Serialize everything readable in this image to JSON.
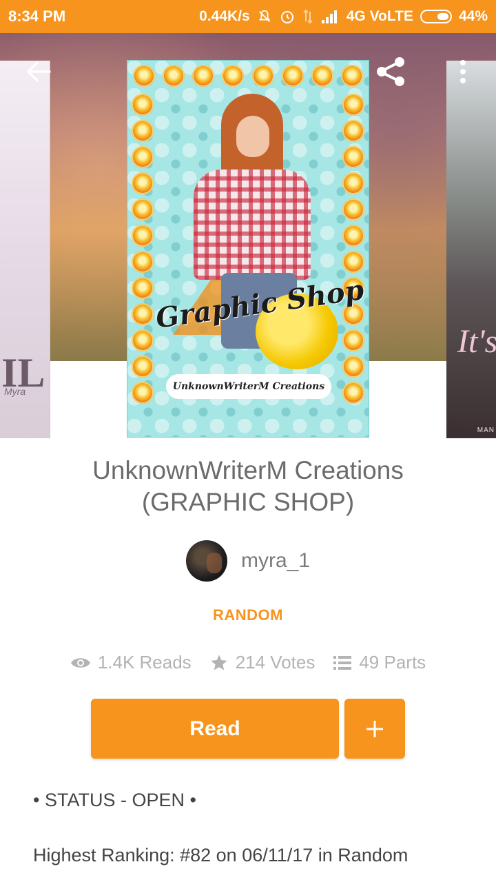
{
  "status_bar": {
    "time": "8:34 PM",
    "speed": "0.44K/s",
    "network": "4G VoLTE",
    "battery": "44%"
  },
  "story": {
    "title": "UnknownWriterM Creations (GRAPHIC SHOP)",
    "author": "myra_1",
    "category": "RANDOM",
    "cover": {
      "title": "Graphic Shop",
      "subtitle": "UnknownWriterM Creations"
    }
  },
  "neighbors": {
    "left_cover_text": "IL",
    "left_cover_small": "Myra",
    "right_cover_text": "It's",
    "right_cover_small": "MAN"
  },
  "stats": {
    "reads": "1.4K Reads",
    "votes": "214 Votes",
    "parts": "49 Parts"
  },
  "actions": {
    "read_label": "Read",
    "add_label": "+"
  },
  "description": {
    "status": "• STATUS - OPEN •",
    "ranking": "Highest Ranking: #82 on 06/11/17 in Random"
  },
  "colors": {
    "accent": "#f7941d",
    "title_text": "#6b6b6b",
    "stat_text": "#b3b3b3"
  },
  "icons": [
    "back-arrow-icon",
    "share-icon",
    "more-vert-icon",
    "eye-icon",
    "star-icon",
    "list-icon",
    "plus-icon",
    "alarm-icon",
    "mute-icon",
    "signal-icon",
    "battery-icon"
  ]
}
